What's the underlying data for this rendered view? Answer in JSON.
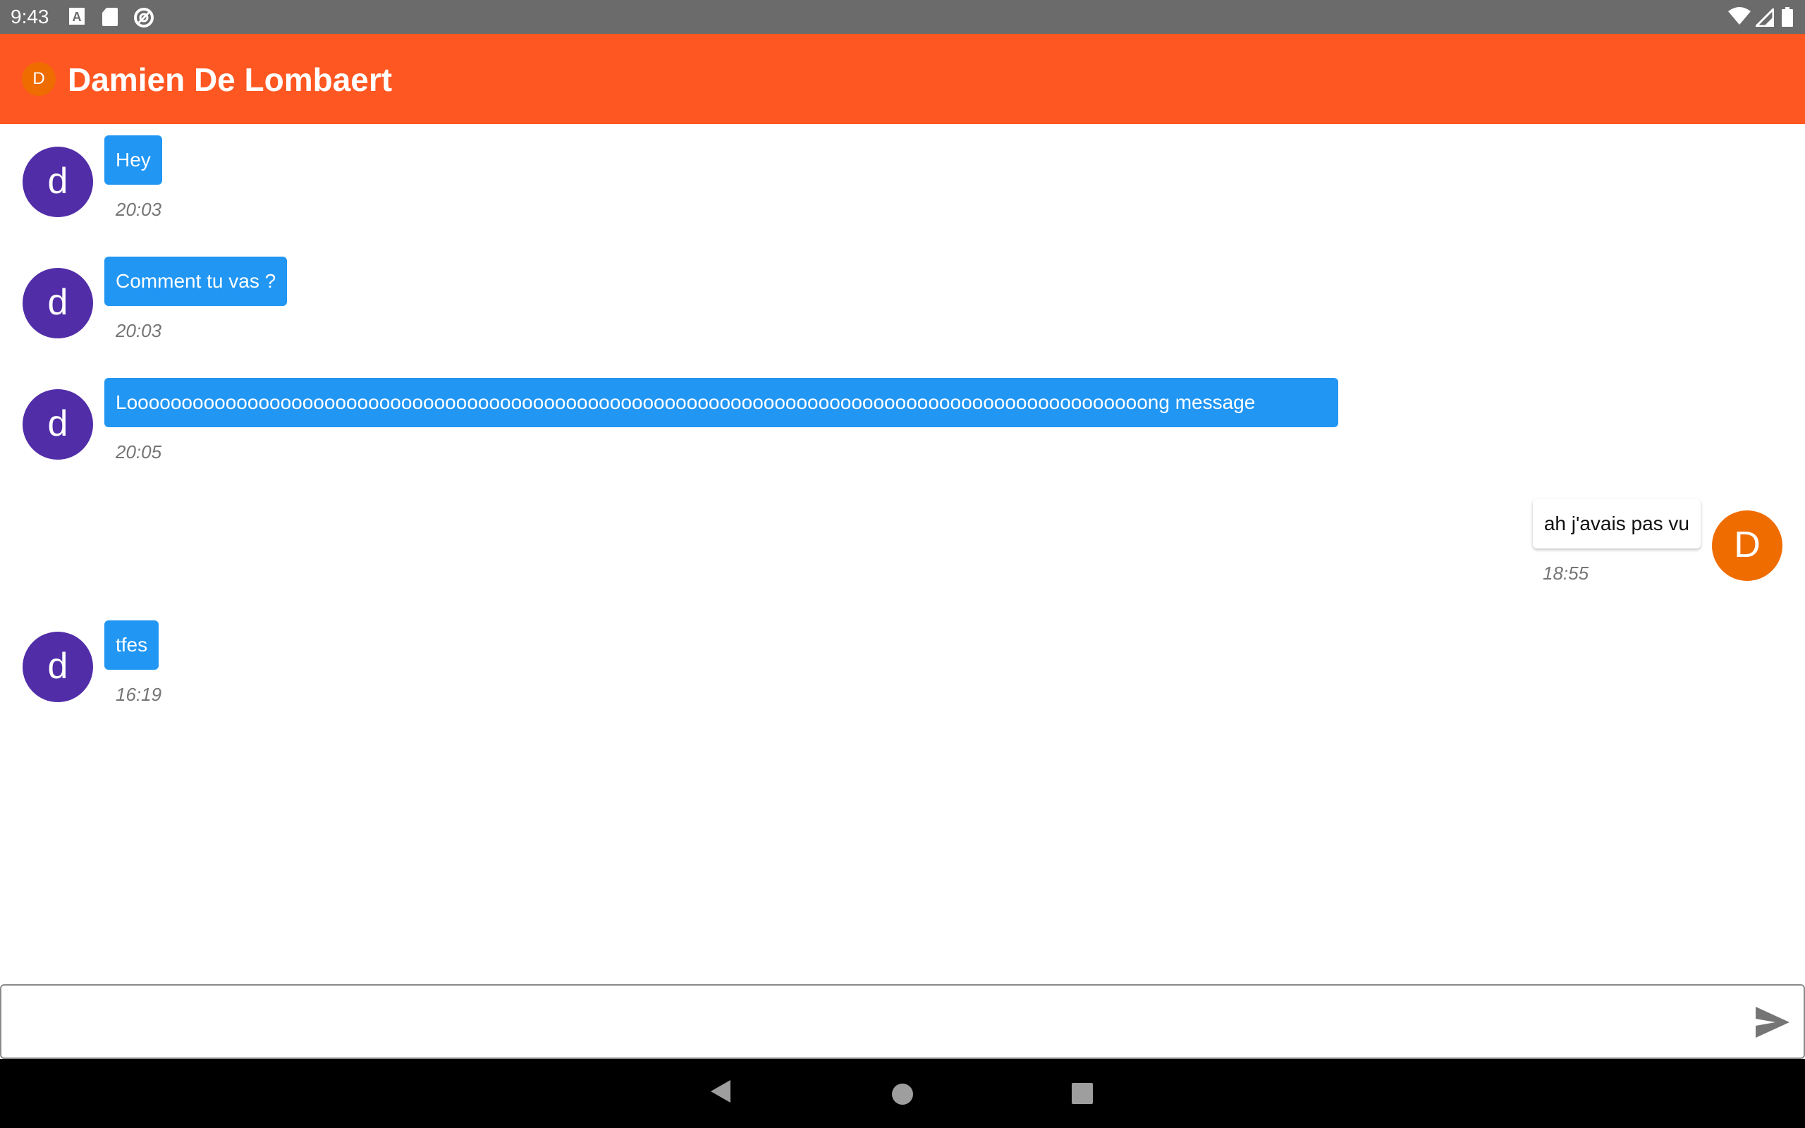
{
  "status_bar": {
    "time": "9:43",
    "left_icons": [
      "keyboard-a-icon",
      "sd-card-icon",
      "vpn-icon"
    ],
    "right_icons": [
      "wifi-icon",
      "signal-icon",
      "battery-icon"
    ]
  },
  "app_bar": {
    "avatar_letter": "D",
    "title": "Damien De Lombaert",
    "color": "#ff5722"
  },
  "messages": [
    {
      "sender": "other",
      "avatar_letter": "d",
      "text": "Hey",
      "time": "20:03"
    },
    {
      "sender": "other",
      "avatar_letter": "d",
      "text": "Comment tu vas ?",
      "time": "20:03"
    },
    {
      "sender": "other",
      "avatar_letter": "d",
      "text": "Looooooooooooooooooooooooooooooooooooooooooooooooooooooooooooooooooooooooooooooooooooooooooooong message",
      "time": "20:05"
    },
    {
      "sender": "me",
      "avatar_letter": "D",
      "text": "ah j'avais pas vu",
      "time": "18:55"
    },
    {
      "sender": "other",
      "avatar_letter": "d",
      "text": "tfes",
      "time": "16:19"
    }
  ],
  "composer": {
    "value": "",
    "placeholder": "",
    "send_icon": "send-icon"
  },
  "nav_bar": {
    "icons": [
      "back-icon",
      "home-icon",
      "recents-icon"
    ]
  },
  "colors": {
    "incoming_bubble": "#2196f3",
    "other_avatar": "#512da8",
    "my_avatar": "#ef6c00"
  }
}
